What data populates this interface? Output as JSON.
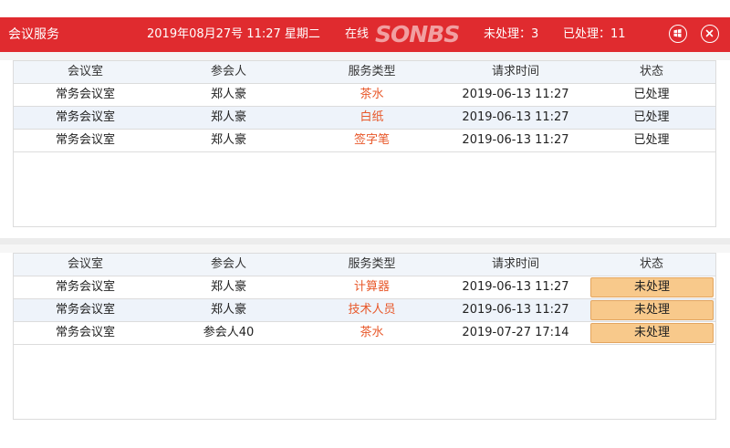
{
  "header": {
    "title": "会议服务",
    "datetime": "2019年08月27号  11:27  星期二",
    "online": "在线",
    "watermark": "SONBS",
    "pending": "未处理：3",
    "processed": "已处理：11",
    "icons": [
      "windows-icon",
      "close-icon"
    ],
    "colors": {
      "bar": "#e02b2f",
      "accent_text": "#e8582a",
      "pending_button": "#f8c98b"
    }
  },
  "columns": [
    "会议室",
    "参会人",
    "服务类型",
    "请求时间",
    "状态"
  ],
  "processed_table": {
    "rows": [
      {
        "room": "常务会议室",
        "person": "郑人豪",
        "type": "茶水",
        "time": "2019-06-13  11:27",
        "status": "已处理"
      },
      {
        "room": "常务会议室",
        "person": "郑人豪",
        "type": "白纸",
        "time": "2019-06-13  11:27",
        "status": "已处理"
      },
      {
        "room": "常务会议室",
        "person": "郑人豪",
        "type": "签字笔",
        "time": "2019-06-13  11:27",
        "status": "已处理"
      }
    ]
  },
  "pending_table": {
    "rows": [
      {
        "room": "常务会议室",
        "person": "郑人豪",
        "type": "计算器",
        "time": "2019-06-13  11:27",
        "status": "未处理"
      },
      {
        "room": "常务会议室",
        "person": "郑人豪",
        "type": "技术人员",
        "time": "2019-06-13  11:27",
        "status": "未处理"
      },
      {
        "room": "常务会议室",
        "person": "参会人40",
        "type": "茶水",
        "time": "2019-07-27  17:14",
        "status": "未处理"
      }
    ]
  }
}
